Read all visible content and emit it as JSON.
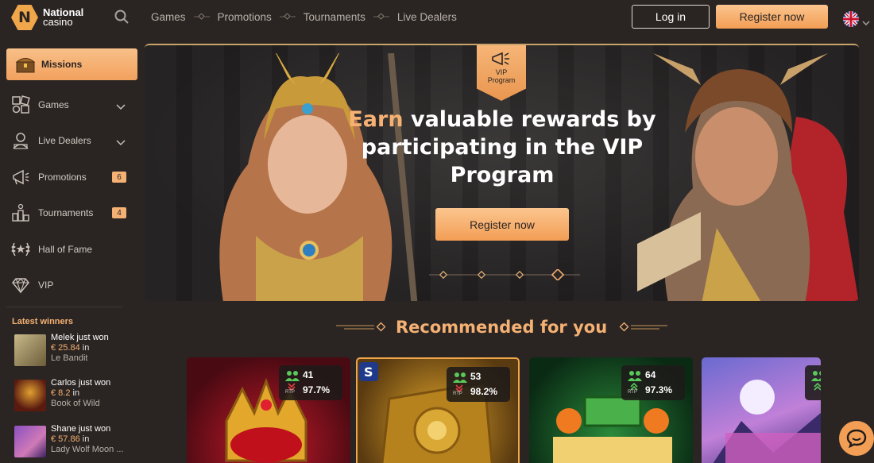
{
  "brand": {
    "name_line1": "National",
    "name_line2": "casino",
    "badge_letter": "N"
  },
  "nav": {
    "items": [
      {
        "label": "Games"
      },
      {
        "label": "Promotions"
      },
      {
        "label": "Tournaments"
      },
      {
        "label": "Live Dealers"
      }
    ]
  },
  "auth": {
    "login_label": "Log in",
    "register_label": "Register now"
  },
  "language": {
    "flag": "UK"
  },
  "sidebar": {
    "missions_label": "Missions",
    "items": [
      {
        "label": "Games",
        "icon": "games-icon"
      },
      {
        "label": "Live Dealers",
        "icon": "live-dealers-icon"
      },
      {
        "label": "Promotions",
        "icon": "megaphone-icon",
        "count": "6"
      },
      {
        "label": "Tournaments",
        "icon": "podium-icon",
        "count": "4"
      },
      {
        "label": "Hall of Fame",
        "icon": "laurel-icon"
      },
      {
        "label": "VIP",
        "icon": "diamond-icon"
      }
    ],
    "latest_winners_title": "Latest winners",
    "winners": [
      {
        "who": "Melek just won",
        "amount": "€ 25.84",
        "in": "in",
        "game": "Le Bandit"
      },
      {
        "who": "Carlos just won",
        "amount": "€ 8.2",
        "in": "in",
        "game": "Book of Wild"
      },
      {
        "who": "Shane just won",
        "amount": "€ 57.86",
        "in": "in",
        "game": "Lady Wolf Moon ..."
      }
    ]
  },
  "hero": {
    "badge_line1": "VIP",
    "badge_line2": "Program",
    "title_accent": "Earn",
    "title_rest": "valuable rewards by participating in the VIP Program",
    "cta_label": "Register now"
  },
  "recommended": {
    "title": "Recommended for you",
    "cards": [
      {
        "players": "41",
        "rtp": "97.7%",
        "trend": "down",
        "rtp_label": "RTP"
      },
      {
        "players": "53",
        "rtp": "98.2%",
        "trend": "down",
        "rtp_label": "RTP"
      },
      {
        "players": "64",
        "rtp": "97.3%",
        "trend": "up",
        "rtp_label": "RTP"
      },
      {
        "players": "",
        "rtp": "",
        "trend": "up",
        "rtp_label": ""
      }
    ]
  },
  "colors": {
    "accent": "#f5b173",
    "background": "#2a2523",
    "button": "#f39e55"
  }
}
